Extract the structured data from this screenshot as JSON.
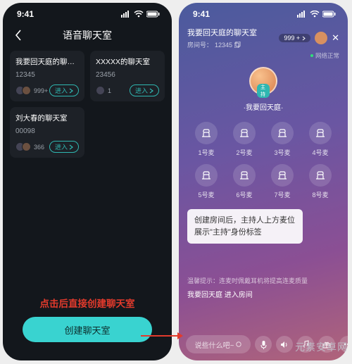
{
  "status": {
    "time": "9:41"
  },
  "left": {
    "title": "语音聊天室",
    "rooms": [
      {
        "name": "我要回天庭的聊天室",
        "code": "12345",
        "count": "999+",
        "enter": "进入"
      },
      {
        "name": "XXXXX的聊天室",
        "code": "23456",
        "count": "1",
        "enter": "进入"
      },
      {
        "name": "刘大春的聊天室",
        "code": "00098",
        "count": "366",
        "enter": "进入"
      }
    ],
    "hint": "点击后直接创建聊天室",
    "create": "创建聊天室"
  },
  "right": {
    "room_title": "我要回天庭的聊天室",
    "room_sub_label": "房间号：",
    "room_sub_value": "12345",
    "count_badge": "999 +",
    "network": "网络正常",
    "host_badge": "主持",
    "host_name": "·我要回天庭·",
    "seats": [
      {
        "label": "1号麦"
      },
      {
        "label": "2号麦"
      },
      {
        "label": "3号麦"
      },
      {
        "label": "4号麦"
      },
      {
        "label": "5号麦"
      },
      {
        "label": "6号麦"
      },
      {
        "label": "7号麦"
      },
      {
        "label": "8号麦"
      }
    ],
    "tip_line1": "创建房间后，主持人上方麦位",
    "tip_line2": "展示\"主持\"身份标签",
    "warm": "温馨提示：连麦时佩戴耳机将提高连麦质量",
    "sysmsg": "我要回天庭 进入房间",
    "say": "说些什么吧~"
  },
  "watermark": "元素安卓网"
}
